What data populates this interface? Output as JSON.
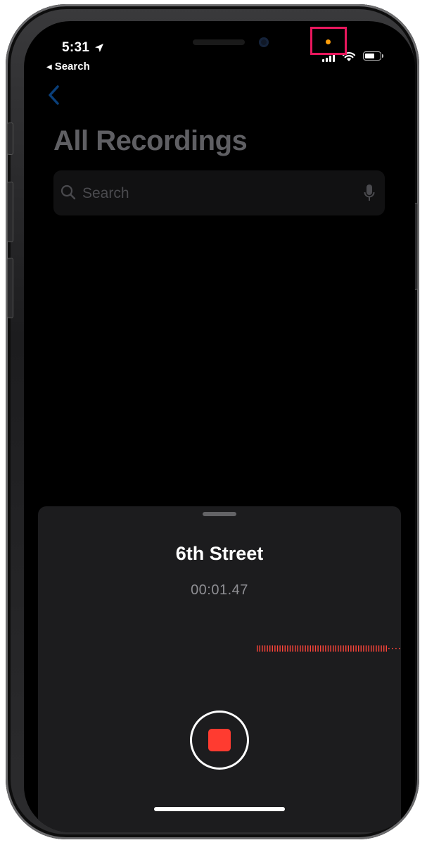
{
  "status_bar": {
    "time": "5:31",
    "back_app_label": "Search",
    "location_icon": "location-arrow-icon",
    "signal_icon": "cellular-signal-icon",
    "wifi_icon": "wifi-icon",
    "battery_icon": "battery-icon",
    "battery_level": 0.7,
    "mic_indicator_color": "#ff9f0a",
    "highlight_color": "#e8175d"
  },
  "nav": {
    "back_icon": "chevron-left-icon",
    "title": "All Recordings"
  },
  "search": {
    "placeholder": "Search",
    "icon": "magnifying-glass-icon",
    "mic_icon": "microphone-icon"
  },
  "recording": {
    "name": "6th Street",
    "elapsed": "00:01.47",
    "stop_button_color": "#ff3b30",
    "waveform_color": "#ff453a"
  },
  "accent_color": "#0a84ff"
}
